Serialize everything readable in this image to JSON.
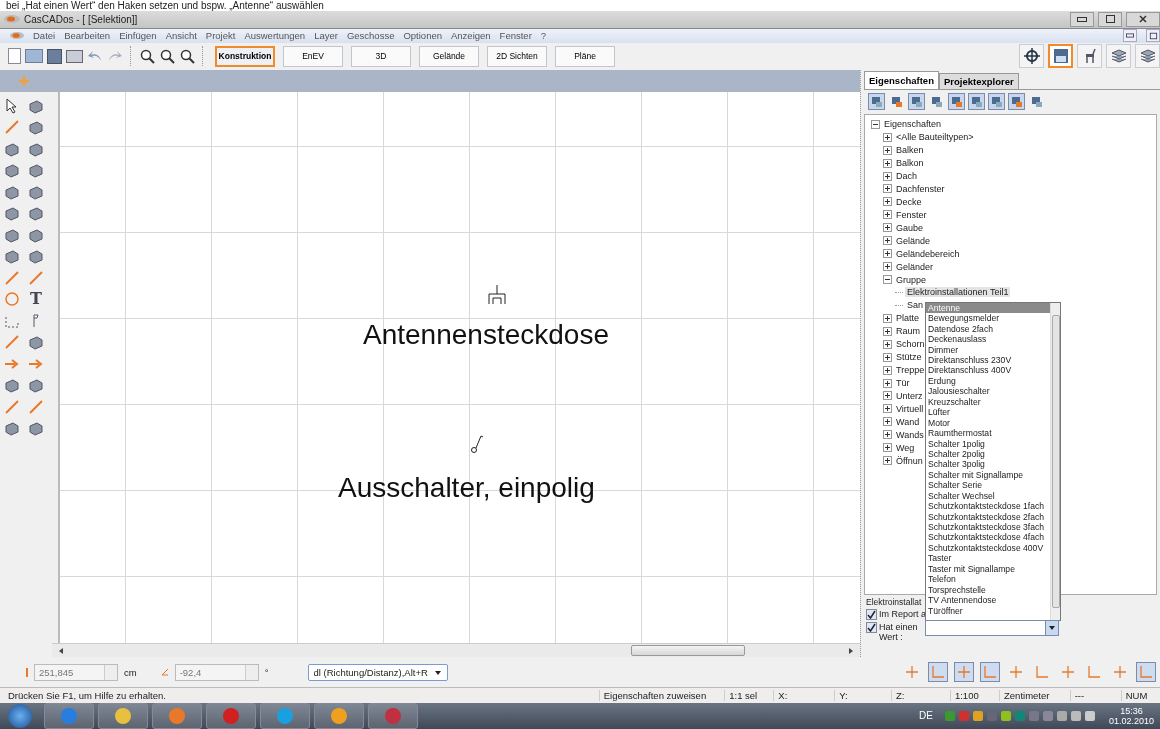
{
  "caption": "bei „Hat einen Wert“ den Haken setzen und bspw. „Antenne“ auswählen",
  "window": {
    "title": "CasCADos - [ [Selektion]]"
  },
  "menu": [
    "Datei",
    "Bearbeiten",
    "Einfügen",
    "Ansicht",
    "Projekt",
    "Auswertungen",
    "Layer",
    "Geschosse",
    "Optionen",
    "Anzeigen",
    "Fenster",
    "?"
  ],
  "mode_tabs": [
    {
      "label": "Konstruktion",
      "selected": true
    },
    {
      "label": "EnEV",
      "selected": false
    },
    {
      "label": "3D",
      "selected": false
    },
    {
      "label": "Gelände",
      "selected": false
    },
    {
      "label": "2D Sichten",
      "selected": false
    },
    {
      "label": "Pläne",
      "selected": false
    }
  ],
  "view_buttons": [
    {
      "kind": "crosshair",
      "selected": false
    },
    {
      "kind": "pro",
      "selected": true
    },
    {
      "kind": "chair",
      "selected": false
    },
    {
      "kind": "layers",
      "selected": false
    },
    {
      "kind": "layers",
      "selected": false
    }
  ],
  "tool_glyph": "T",
  "canvas": {
    "labels": [
      {
        "kind": "antenna",
        "text": "Antennensteckdose"
      },
      {
        "kind": "switch",
        "text": "Ausschalter, einpolig"
      }
    ]
  },
  "panel": {
    "tabs": [
      {
        "label": "Eigenschaften",
        "selected": true
      },
      {
        "label": "Projektexplorer",
        "selected": false
      }
    ],
    "tool_buttons": [
      {
        "pressed": true
      },
      {
        "pressed": false
      },
      {
        "pressed": true
      },
      {
        "pressed": false
      },
      {
        "pressed": true
      },
      {
        "pressed": true
      },
      {
        "pressed": true
      },
      {
        "pressed": true
      },
      {
        "pressed": false
      }
    ],
    "tree": [
      {
        "label": "Eigenschaften",
        "expanded": true,
        "selected": false,
        "children": [
          {
            "label": "<Alle Bauteiltypen>",
            "expanded": false,
            "selected": false
          },
          {
            "label": "Balken",
            "expanded": false,
            "selected": false
          },
          {
            "label": "Balkon",
            "expanded": false,
            "selected": false
          },
          {
            "label": "Dach",
            "expanded": false,
            "selected": false
          },
          {
            "label": "Dachfenster",
            "expanded": false,
            "selected": false
          },
          {
            "label": "Decke",
            "expanded": false,
            "selected": false
          },
          {
            "label": "Fenster",
            "expanded": false,
            "selected": false
          },
          {
            "label": "Gaube",
            "expanded": false,
            "selected": false
          },
          {
            "label": "Gelände",
            "expanded": false,
            "selected": false
          },
          {
            "label": "Geländebereich",
            "expanded": false,
            "selected": false
          },
          {
            "label": "Geländer",
            "expanded": false,
            "selected": false
          },
          {
            "label": "Gruppe",
            "expanded": true,
            "selected": false,
            "children": [
              {
                "label": "Elektroinstallationen Teil1",
                "selected": true
              },
              {
                "label": "San",
                "selected": false
              }
            ]
          },
          {
            "label": "Platte",
            "expanded": false,
            "selected": false
          },
          {
            "label": "Raum",
            "expanded": false,
            "selected": false
          },
          {
            "label": "Schorn",
            "expanded": false,
            "selected": false
          },
          {
            "label": "Stütze",
            "expanded": false,
            "selected": false
          },
          {
            "label": "Treppe",
            "expanded": false,
            "selected": false
          },
          {
            "label": "Tür",
            "expanded": false,
            "selected": false
          },
          {
            "label": "Unterz",
            "expanded": false,
            "selected": false
          },
          {
            "label": "Virtuell",
            "expanded": false,
            "selected": false
          },
          {
            "label": "Wand",
            "expanded": false,
            "selected": false
          },
          {
            "label": "Wands",
            "expanded": false,
            "selected": false
          },
          {
            "label": "Weg",
            "expanded": false,
            "selected": false
          },
          {
            "label": "Öffnun",
            "expanded": false,
            "selected": false
          }
        ]
      }
    ],
    "options": [
      {
        "label": "Antenne",
        "selected": true
      },
      {
        "label": "Bewegungsmelder",
        "selected": false
      },
      {
        "label": "Datendose 2fach",
        "selected": false
      },
      {
        "label": "Deckenauslass",
        "selected": false
      },
      {
        "label": "Dimmer",
        "selected": false
      },
      {
        "label": "Direktanschluss 230V",
        "selected": false
      },
      {
        "label": "Direktanschluss 400V",
        "selected": false
      },
      {
        "label": "Erdung",
        "selected": false
      },
      {
        "label": "Jalousieschalter",
        "selected": false
      },
      {
        "label": "Kreuzschalter",
        "selected": false
      },
      {
        "label": "Lüfter",
        "selected": false
      },
      {
        "label": "Motor",
        "selected": false
      },
      {
        "label": "Raumthermostat",
        "selected": false
      },
      {
        "label": "Schalter 1polig",
        "selected": false
      },
      {
        "label": "Schalter 2polig",
        "selected": false
      },
      {
        "label": "Schalter 3polig",
        "selected": false
      },
      {
        "label": "Schalter mit Signallampe",
        "selected": false
      },
      {
        "label": "Schalter Serie",
        "selected": false
      },
      {
        "label": "Schalter Wechsel",
        "selected": false
      },
      {
        "label": "Schutzkontaktsteckdose 1fach",
        "selected": false
      },
      {
        "label": "Schutzkontaktsteckdose 2fach",
        "selected": false
      },
      {
        "label": "Schutzkontaktsteckdose 3fach",
        "selected": false
      },
      {
        "label": "Schutzkontaktsteckdose 4fach",
        "selected": false
      },
      {
        "label": "Schutzkontaktsteckdose 400V",
        "selected": false
      },
      {
        "label": "Taster",
        "selected": false
      },
      {
        "label": "Taster mit Signallampe",
        "selected": false
      },
      {
        "label": "Telefon",
        "selected": false
      },
      {
        "label": "Torsprechstelle",
        "selected": false
      },
      {
        "label": "TV Antennendose",
        "selected": false
      },
      {
        "label": "Türöffner",
        "selected": false
      }
    ],
    "group_label": "Elektroinstallat",
    "checks": [
      {
        "label": "Im Report a",
        "checked": true
      },
      {
        "label": "Hat einen Wert :",
        "checked": true
      }
    ]
  },
  "coords": {
    "length": "251,845",
    "length_unit": "cm",
    "angle": "-92,4",
    "angle_unit": "°",
    "mode": "dl (Richtung/Distanz),Alt+R"
  },
  "snap_buttons": [
    {
      "pressed": false
    },
    {
      "pressed": true
    },
    {
      "pressed": true
    },
    {
      "pressed": true
    },
    {
      "pressed": false
    },
    {
      "pressed": false
    },
    {
      "pressed": false
    },
    {
      "pressed": false
    },
    {
      "pressed": false
    },
    {
      "pressed": true
    }
  ],
  "status": {
    "hint": "Drücken Sie F1, um Hilfe zu erhalten.",
    "cells": [
      "Eigenschaften zuweisen",
      "1:1 sel",
      "X:",
      "Y:",
      "Z:",
      "1:100",
      "Zentimeter",
      "---",
      "NUM"
    ]
  },
  "taskbar": {
    "language": "DE",
    "time": "15:36",
    "date": "01.02.2010"
  }
}
